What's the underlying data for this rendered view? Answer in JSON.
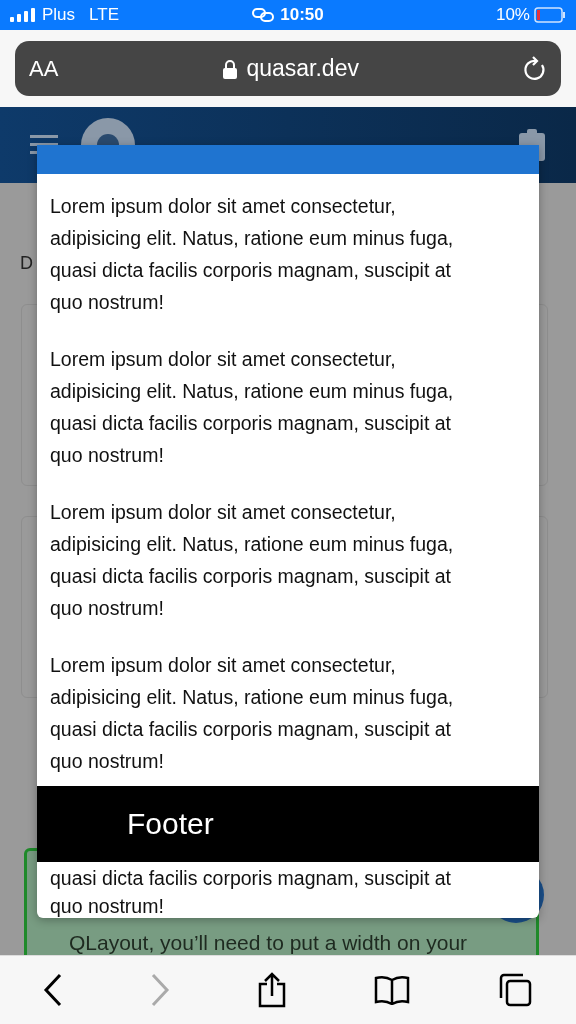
{
  "status_bar": {
    "carrier": "Plus",
    "network": "LTE",
    "time": "10:50",
    "battery": "10%"
  },
  "address_bar": {
    "text_size_button": "AA",
    "url": "quasar.dev"
  },
  "page": {
    "text": "D",
    "note_line": "QLayout, you’ll need to put a width on your"
  },
  "dialog": {
    "paragraphs": [
      "Lorem ipsum dolor sit amet consectetur, adipisicing elit. Natus, ratione eum minus fuga, quasi dicta facilis corporis magnam, suscipit at quo nostrum!",
      "Lorem ipsum dolor sit amet consectetur, adipisicing elit. Natus, ratione eum minus fuga, quasi dicta facilis corporis magnam, suscipit at quo nostrum!",
      "Lorem ipsum dolor sit amet consectetur, adipisicing elit. Natus, ratione eum minus fuga, quasi dicta facilis corporis magnam, suscipit at quo nostrum!",
      "Lorem ipsum dolor sit amet consectetur, adipisicing elit. Natus, ratione eum minus fuga, quasi dicta facilis corporis magnam, suscipit at quo nostrum!"
    ],
    "footer": "Footer",
    "scrolled_lines": [
      "quasi dicta facilis corporis magnam, suscipit at",
      "quo nostrum!"
    ]
  }
}
